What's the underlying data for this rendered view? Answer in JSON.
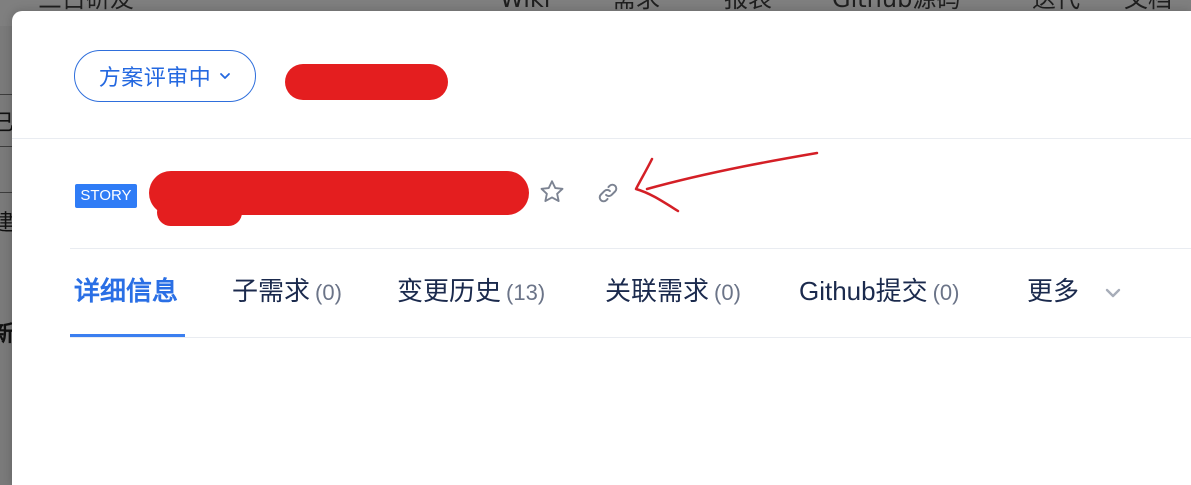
{
  "background": {
    "nav_items": [
      "三占研友",
      "Wiki",
      "需求",
      "报表",
      "Github源码",
      "迭代",
      "文档"
    ],
    "left_chars": [
      "已",
      "建",
      "新"
    ]
  },
  "header": {
    "status_label": "方案评审中",
    "status_icon": "chevron-down-icon"
  },
  "story": {
    "badge": "STORY",
    "favorite_icon": "star-icon",
    "link_icon": "link-icon"
  },
  "tabs": [
    {
      "label": "详细信息",
      "count": ""
    },
    {
      "label": "子需求",
      "count": "(0)"
    },
    {
      "label": "变更历史",
      "count": "(13)"
    },
    {
      "label": "关联需求",
      "count": "(0)"
    },
    {
      "label": "Github提交",
      "count": "(0)"
    },
    {
      "label": "更多",
      "count": ""
    }
  ],
  "colors": {
    "accent": "#2a6fe5",
    "badge": "#2f7cf6",
    "redaction": "#e41e1f",
    "annotation_arrow": "#d41f26"
  }
}
